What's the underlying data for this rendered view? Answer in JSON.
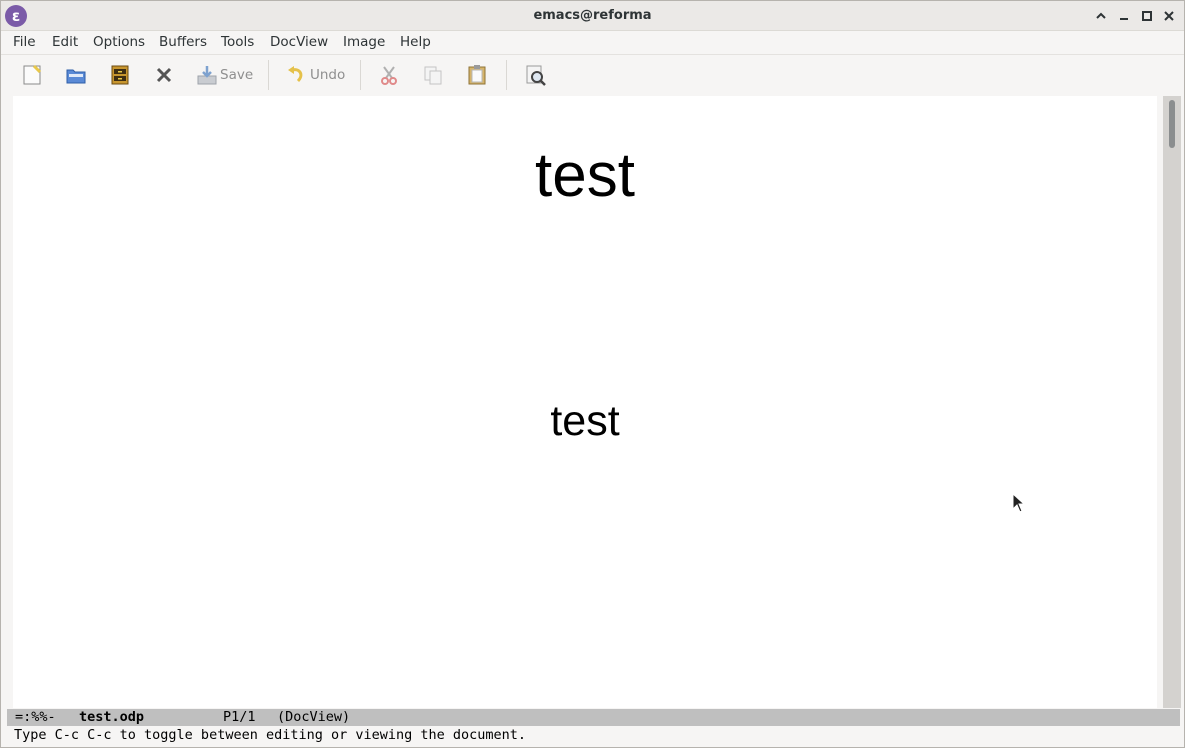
{
  "window": {
    "title": "emacs@reforma",
    "controls": [
      "chevron-up",
      "minimize",
      "maximize",
      "close"
    ]
  },
  "menubar": {
    "items": [
      "File",
      "Edit",
      "Options",
      "Buffers",
      "Tools",
      "DocView",
      "Image",
      "Help"
    ]
  },
  "toolbar": {
    "new_file_icon": "new-file-icon",
    "open_icon": "open-folder-icon",
    "dired_icon": "file-cabinet-icon",
    "close_icon": "close-icon",
    "save_label": "Save",
    "undo_label": "Undo",
    "cut_icon": "scissors-icon",
    "copy_icon": "copy-icon",
    "paste_icon": "paste-icon",
    "search_icon": "magnifier-icon"
  },
  "document": {
    "title_text": "test",
    "body_text": "test"
  },
  "modeline": {
    "status": "=:%%-",
    "buffer_name": "test.odp",
    "position": "P1/1",
    "mode": "(DocView)"
  },
  "echo_area": {
    "message": "Type C-c C-c to toggle between editing or viewing the document."
  },
  "colors": {
    "emacs_purple": "#7b5ba8",
    "modeline_bg": "#bfbfbf"
  }
}
